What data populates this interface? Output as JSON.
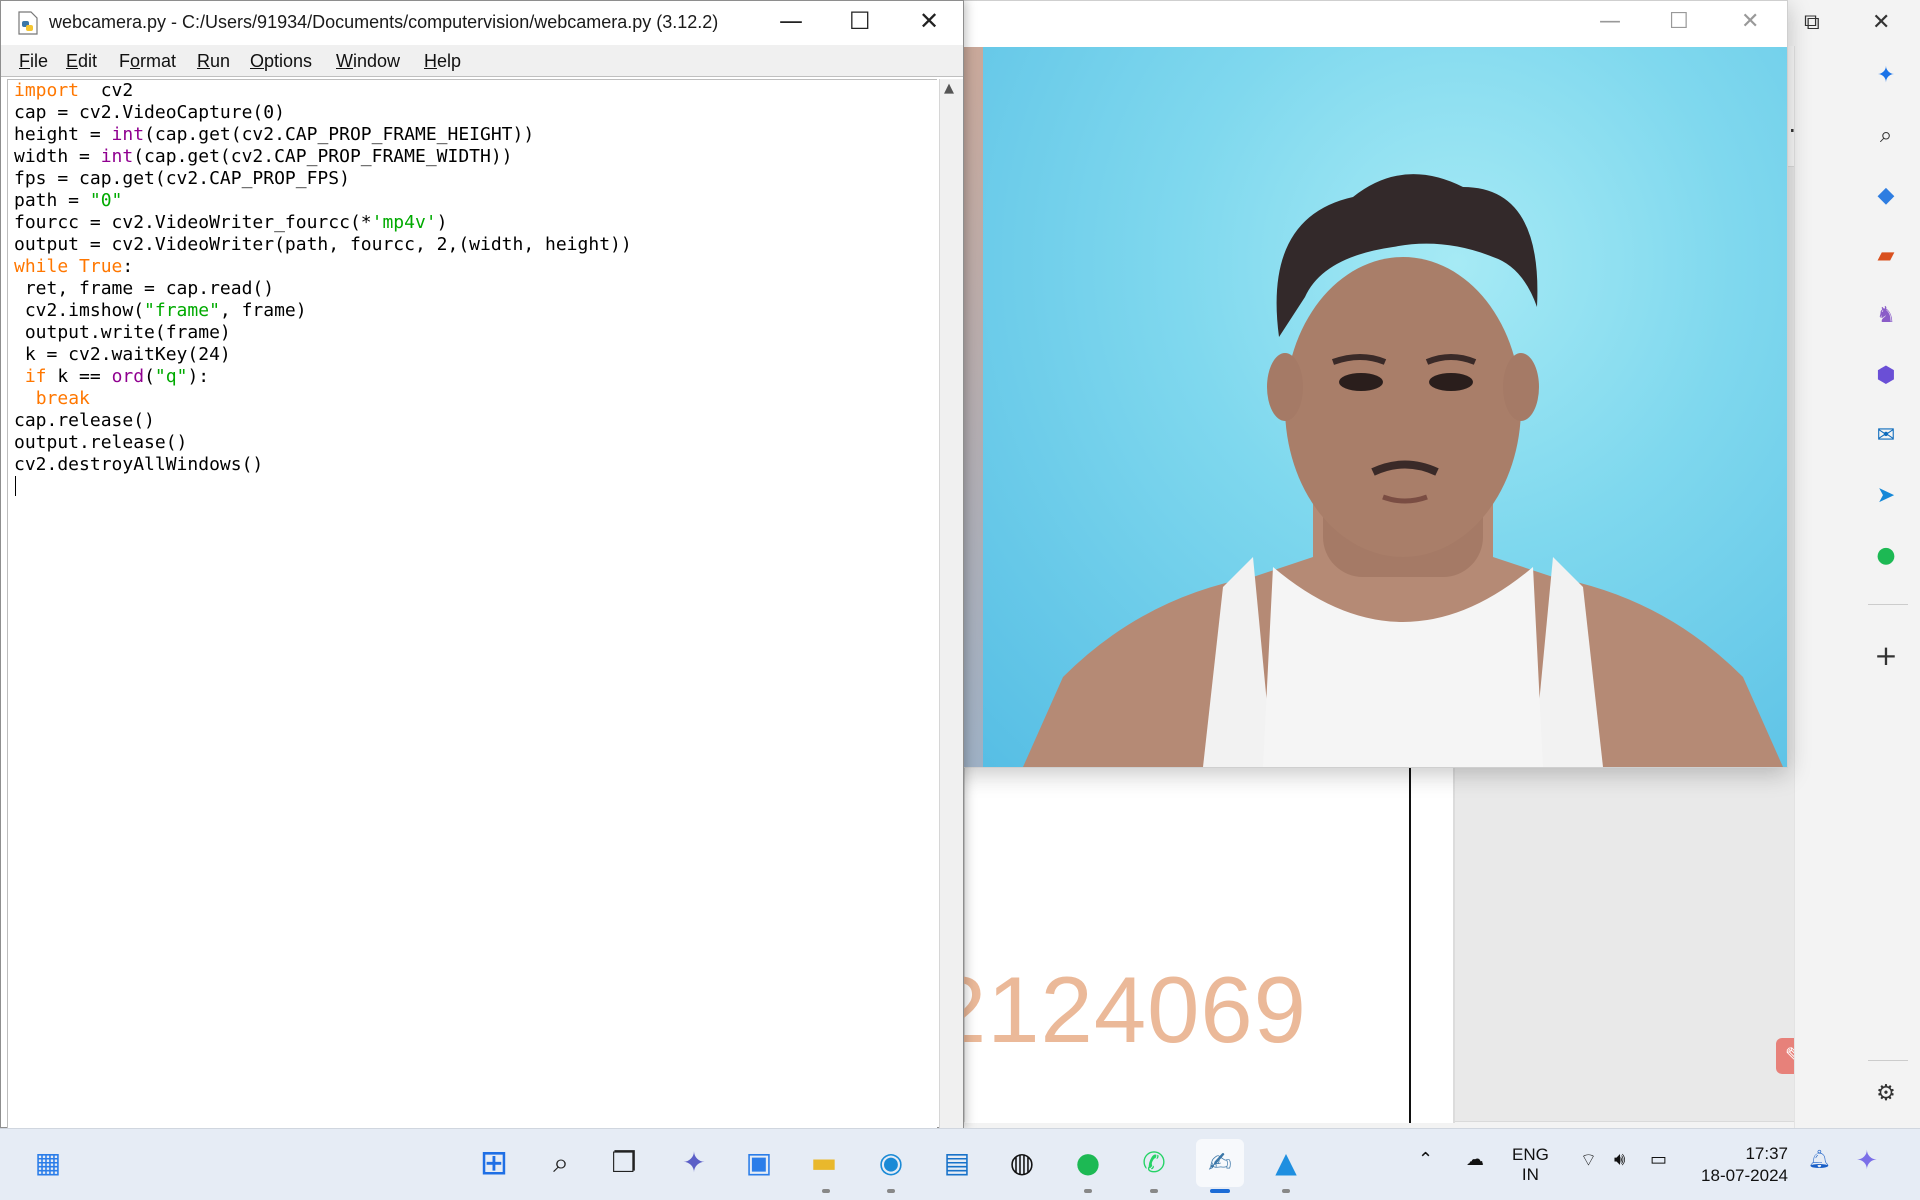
{
  "idle": {
    "title": "webcamera.py - C:/Users/91934/Documents/computervision/webcamera.py (3.12.2)",
    "menu": [
      {
        "pre": "",
        "u": "F",
        "post": "ile"
      },
      {
        "pre": "",
        "u": "E",
        "post": "dit"
      },
      {
        "pre": "F",
        "u": "o",
        "post": "rmat"
      },
      {
        "pre": "",
        "u": "R",
        "post": "un"
      },
      {
        "pre": "",
        "u": "O",
        "post": "ptions"
      },
      {
        "pre": "",
        "u": "W",
        "post": "indow"
      },
      {
        "pre": "",
        "u": "H",
        "post": "elp"
      }
    ],
    "code": [
      [
        [
          "kw",
          "import"
        ],
        [
          "",
          "  cv2"
        ]
      ],
      [
        [
          "",
          "cap = cv2.VideoCapture(0)"
        ]
      ],
      [
        [
          "",
          "height = "
        ],
        [
          "bi",
          "int"
        ],
        [
          "",
          "(cap.get(cv2.CAP_PROP_FRAME_HEIGHT))"
        ]
      ],
      [
        [
          "",
          "width = "
        ],
        [
          "bi",
          "int"
        ],
        [
          "",
          "(cap.get(cv2.CAP_PROP_FRAME_WIDTH))"
        ]
      ],
      [
        [
          "",
          "fps = cap.get(cv2.CAP_PROP_FPS)"
        ]
      ],
      [
        [
          "",
          "path = "
        ],
        [
          "st",
          "\"0\""
        ]
      ],
      [
        [
          "",
          "fourcc = cv2.VideoWriter_fourcc(*"
        ],
        [
          "st",
          "'mp4v'"
        ],
        [
          "",
          ")"
        ]
      ],
      [
        [
          "",
          "output = cv2.VideoWriter(path, fourcc, 2,(width, height))"
        ]
      ],
      [
        [
          "kw",
          "while"
        ],
        [
          "",
          " "
        ],
        [
          "kw",
          "True"
        ],
        [
          "",
          ":"
        ]
      ],
      [
        [
          "",
          " ret, frame = cap.read()"
        ]
      ],
      [
        [
          "",
          " cv2.imshow("
        ],
        [
          "st",
          "\"frame\""
        ],
        [
          "",
          ", frame)"
        ]
      ],
      [
        [
          "",
          " output.write(frame)"
        ]
      ],
      [
        [
          "",
          " k = cv2.waitKey(24)"
        ]
      ],
      [
        [
          "",
          " "
        ],
        [
          "kw",
          "if"
        ],
        [
          "",
          " k == "
        ],
        [
          "bi",
          "ord"
        ],
        [
          "",
          "("
        ],
        [
          "st",
          "\"q\""
        ],
        [
          "",
          "):"
        ]
      ],
      [
        [
          "",
          "  "
        ],
        [
          "kw",
          "break"
        ]
      ],
      [
        [
          "",
          "cap.release()"
        ]
      ],
      [
        [
          "",
          "output.release()"
        ]
      ],
      [
        [
          "",
          "cv2.destroyAllWindows()"
        ]
      ]
    ]
  },
  "pdf": {
    "visible_number": "2124069"
  },
  "taskbar": {
    "language": "ENG",
    "region": "IN",
    "time": "17:37",
    "date": "18-07-2024"
  },
  "colors": {
    "keyword": "#ff7700",
    "builtin": "#900090",
    "string": "#00aa00",
    "taskbar_bg": "#e6ecf5",
    "active_indicator": "#1b6bd6"
  }
}
